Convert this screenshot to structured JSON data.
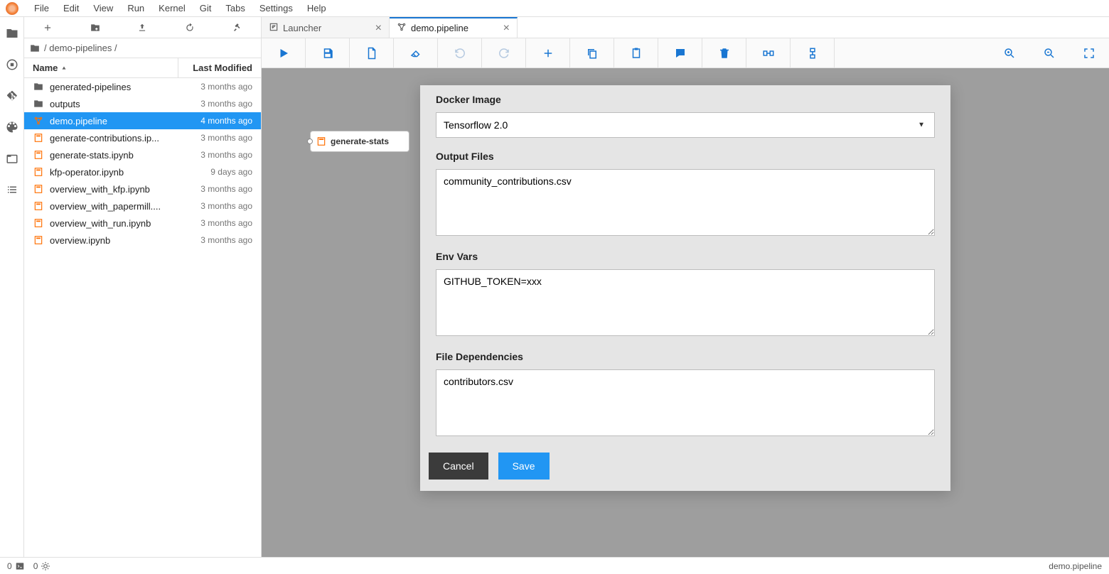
{
  "menubar": [
    "File",
    "Edit",
    "View",
    "Run",
    "Kernel",
    "Git",
    "Tabs",
    "Settings",
    "Help"
  ],
  "filebrowser": {
    "breadcrumb": "/ demo-pipelines /",
    "columns": {
      "name": "Name",
      "modified": "Last Modified"
    },
    "items": [
      {
        "icon": "folder",
        "name": "generated-pipelines",
        "modified": "3 months ago",
        "selected": false
      },
      {
        "icon": "folder",
        "name": "outputs",
        "modified": "3 months ago",
        "selected": false
      },
      {
        "icon": "pipeline",
        "name": "demo.pipeline",
        "modified": "4 months ago",
        "selected": true
      },
      {
        "icon": "notebook",
        "name": "generate-contributions.ip...",
        "modified": "3 months ago",
        "selected": false
      },
      {
        "icon": "notebook",
        "name": "generate-stats.ipynb",
        "modified": "3 months ago",
        "selected": false
      },
      {
        "icon": "notebook",
        "name": "kfp-operator.ipynb",
        "modified": "9 days ago",
        "selected": false
      },
      {
        "icon": "notebook",
        "name": "overview_with_kfp.ipynb",
        "modified": "3 months ago",
        "selected": false
      },
      {
        "icon": "notebook",
        "name": "overview_with_papermill....",
        "modified": "3 months ago",
        "selected": false
      },
      {
        "icon": "notebook",
        "name": "overview_with_run.ipynb",
        "modified": "3 months ago",
        "selected": false
      },
      {
        "icon": "notebook",
        "name": "overview.ipynb",
        "modified": "3 months ago",
        "selected": false
      }
    ]
  },
  "tabs": [
    {
      "label": "Launcher",
      "icon": "launcher",
      "active": false
    },
    {
      "label": "demo.pipeline",
      "icon": "pipeline",
      "active": true
    }
  ],
  "canvas": {
    "node_label": "generate-stats"
  },
  "dialog": {
    "docker_image": {
      "label": "Docker Image",
      "value": "Tensorflow 2.0"
    },
    "output_files": {
      "label": "Output Files",
      "value": "community_contributions.csv"
    },
    "env_vars": {
      "label": "Env Vars",
      "value": "GITHUB_TOKEN=xxx"
    },
    "file_deps": {
      "label": "File Dependencies",
      "value": "contributors.csv"
    },
    "cancel": "Cancel",
    "save": "Save"
  },
  "statusbar": {
    "terminals": "0",
    "kernels": "0",
    "right": "demo.pipeline"
  }
}
